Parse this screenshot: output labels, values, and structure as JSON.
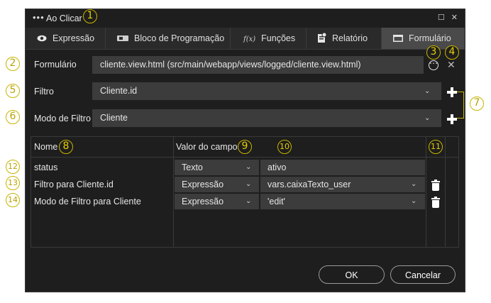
{
  "window": {
    "title_dots": "•••",
    "title": "Ao Clicar",
    "maximize_glyph": "☐",
    "close_glyph": "✕"
  },
  "tabs": [
    {
      "label": "Expressão",
      "icon": "eye-icon",
      "glyph": "👁"
    },
    {
      "label": "Bloco de Programação",
      "icon": "blocks-icon",
      "glyph": "▰"
    },
    {
      "label": "Funções",
      "icon": "function-icon",
      "glyph": "f(x)"
    },
    {
      "label": "Relatório",
      "icon": "report-icon",
      "glyph": "▣"
    },
    {
      "label": "Formulário",
      "icon": "form-icon",
      "glyph": "▬",
      "active": true
    }
  ],
  "form": {
    "formulario_label": "Formulário",
    "formulario_value": "cliente.view.html (src/main/webapp/views/logged/cliente.view.html)",
    "more_glyph": "⋯",
    "clear_glyph": "✕",
    "filtro_label": "Filtro",
    "filtro_value": "Cliente.id",
    "modo_label": "Modo de Filtro",
    "modo_value": "Cliente",
    "chevron": "⌄"
  },
  "grid": {
    "col_nome": "Nome",
    "col_valor": "Valor do campo",
    "rows": [
      {
        "nome": "status",
        "tipo": "Texto",
        "valor": "ativo",
        "valor_dropdown": false,
        "deletable": false
      },
      {
        "nome": "Filtro para Cliente.id",
        "tipo": "Expressão",
        "valor": "vars.caixaTexto_user",
        "valor_dropdown": true,
        "deletable": true
      },
      {
        "nome": "Modo de Filtro para Cliente",
        "tipo": "Expressão",
        "valor": "'edit'",
        "valor_dropdown": true,
        "deletable": true
      }
    ]
  },
  "buttons": {
    "ok": "OK",
    "cancel": "Cancelar"
  },
  "callouts": [
    "1",
    "2",
    "3",
    "4",
    "5",
    "6",
    "7",
    "8",
    "9",
    "10",
    "11",
    "12",
    "13",
    "14"
  ],
  "colors": {
    "dialog_bg": "#1e1e1e",
    "field_bg": "#3c3c3c",
    "active_tab": "#4a4a4a",
    "callout": "#c8b400"
  }
}
